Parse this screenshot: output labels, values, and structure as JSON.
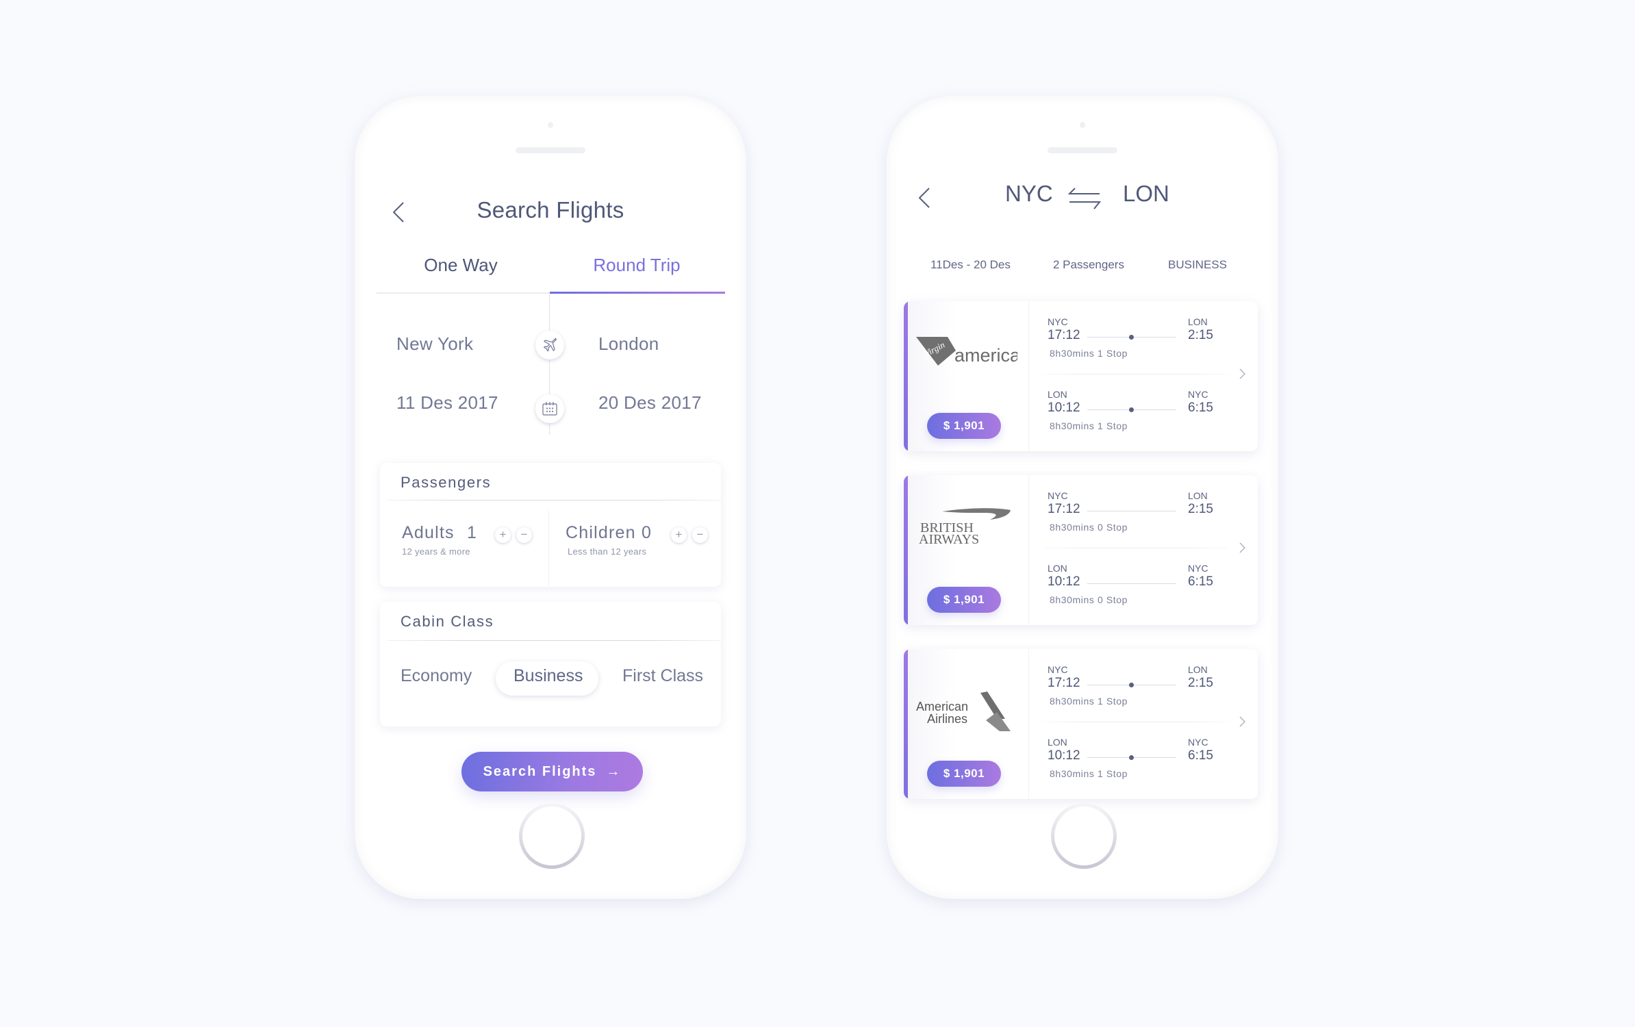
{
  "search_screen": {
    "title": "Search Flights",
    "tabs": [
      {
        "label": "One Way",
        "active": false
      },
      {
        "label": "Round Trip",
        "active": true
      }
    ],
    "from_city": "New York",
    "to_city": "London",
    "depart_date": "11 Des 2017",
    "return_date": "20 Des 2017",
    "passengers": {
      "title": "Passengers",
      "adults": {
        "label": "Adults",
        "count": "1",
        "sub": "12 years & more"
      },
      "children": {
        "label": "Children",
        "count": "0",
        "sub": "Less than 12 years"
      },
      "plus": "+",
      "minus": "−"
    },
    "cabin": {
      "title": "Cabin Class",
      "options": [
        "Economy",
        "Business",
        "First Class"
      ],
      "selected": "Business"
    },
    "search_button": {
      "label": "Search Flights",
      "arrow": "→"
    }
  },
  "results_screen": {
    "from_code": "NYC",
    "to_code": "LON",
    "swap_icon": "swap-arrows-icon",
    "dates": "11Des - 20 Des",
    "passengers": "2 Passengers",
    "cabin": "BUSINESS",
    "flights": [
      {
        "airline": "Virgin America",
        "logo_text": "america",
        "logo_script": "Virgin",
        "price": "$ 1,901",
        "outbound": {
          "from": "NYC",
          "to": "LON",
          "depart": "17:12",
          "arrive": "2:15",
          "duration": "8h30mins 1 Stop",
          "stops": 1
        },
        "inbound": {
          "from": "LON",
          "to": "NYC",
          "depart": "10:12",
          "arrive": "6:15",
          "duration": "8h30mins 1 Stop",
          "stops": 1
        }
      },
      {
        "airline": "British Airways",
        "logo_line1": "BRITISH",
        "logo_line2": "AIRWAYS",
        "price": "$ 1,901",
        "outbound": {
          "from": "NYC",
          "to": "LON",
          "depart": "17:12",
          "arrive": "2:15",
          "duration": "8h30mins 0 Stop",
          "stops": 0
        },
        "inbound": {
          "from": "LON",
          "to": "NYC",
          "depart": "10:12",
          "arrive": "6:15",
          "duration": "8h30mins 0 Stop",
          "stops": 0
        }
      },
      {
        "airline": "American Airlines",
        "logo_line1": "American",
        "logo_line2": "Airlines",
        "price": "$ 1,901",
        "outbound": {
          "from": "NYC",
          "to": "LON",
          "depart": "17:12",
          "arrive": "2:15",
          "duration": "8h30mins 1 Stop",
          "stops": 1
        },
        "inbound": {
          "from": "LON",
          "to": "NYC",
          "depart": "10:12",
          "arrive": "6:15",
          "duration": "8h30mins 1 Stop",
          "stops": 1
        }
      }
    ]
  },
  "colors": {
    "background": "#f9fafe",
    "accent_start": "#6d6fe0",
    "accent_end": "#aa7ae0",
    "text_primary": "#505878",
    "text_secondary": "#727893"
  }
}
